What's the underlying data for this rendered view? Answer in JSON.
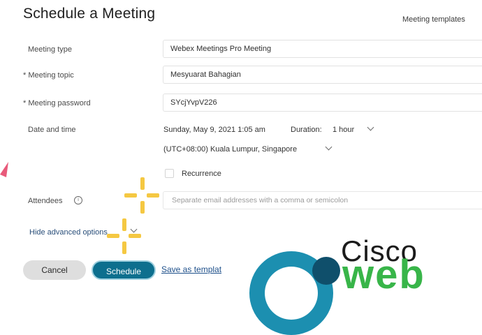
{
  "header": {
    "title": "Schedule a Meeting",
    "templates_link": "Meeting templates"
  },
  "form": {
    "meeting_type": {
      "label": "Meeting type",
      "value": "Webex Meetings Pro Meeting"
    },
    "meeting_topic": {
      "label": "* Meeting topic",
      "value": "Mesyuarat Bahagian"
    },
    "meeting_password": {
      "label": "* Meeting password",
      "value": "SYcjYvpV226"
    },
    "date_time": {
      "label": "Date and time",
      "datetime": "Sunday, May 9, 2021 1:05 am",
      "duration_label": "Duration:",
      "duration_value": "1 hour",
      "timezone": "(UTC+08:00) Kuala Lumpur, Singapore"
    },
    "recurrence": {
      "label": "Recurrence",
      "checked": false
    },
    "attendees": {
      "label": "Attendees",
      "placeholder": "Separate email addresses with a comma or semicolon"
    },
    "advanced_link": "Hide advanced options"
  },
  "actions": {
    "cancel": "Cancel",
    "schedule": "Schedule",
    "save_template": "Save as templat"
  },
  "logo": {
    "line1": "Cisco",
    "line2": "web"
  },
  "colors": {
    "primary": "#0d6f8e",
    "annotation": "#f5c842",
    "logo_green": "#38b549",
    "logo_blue": "#1c8fb0"
  }
}
